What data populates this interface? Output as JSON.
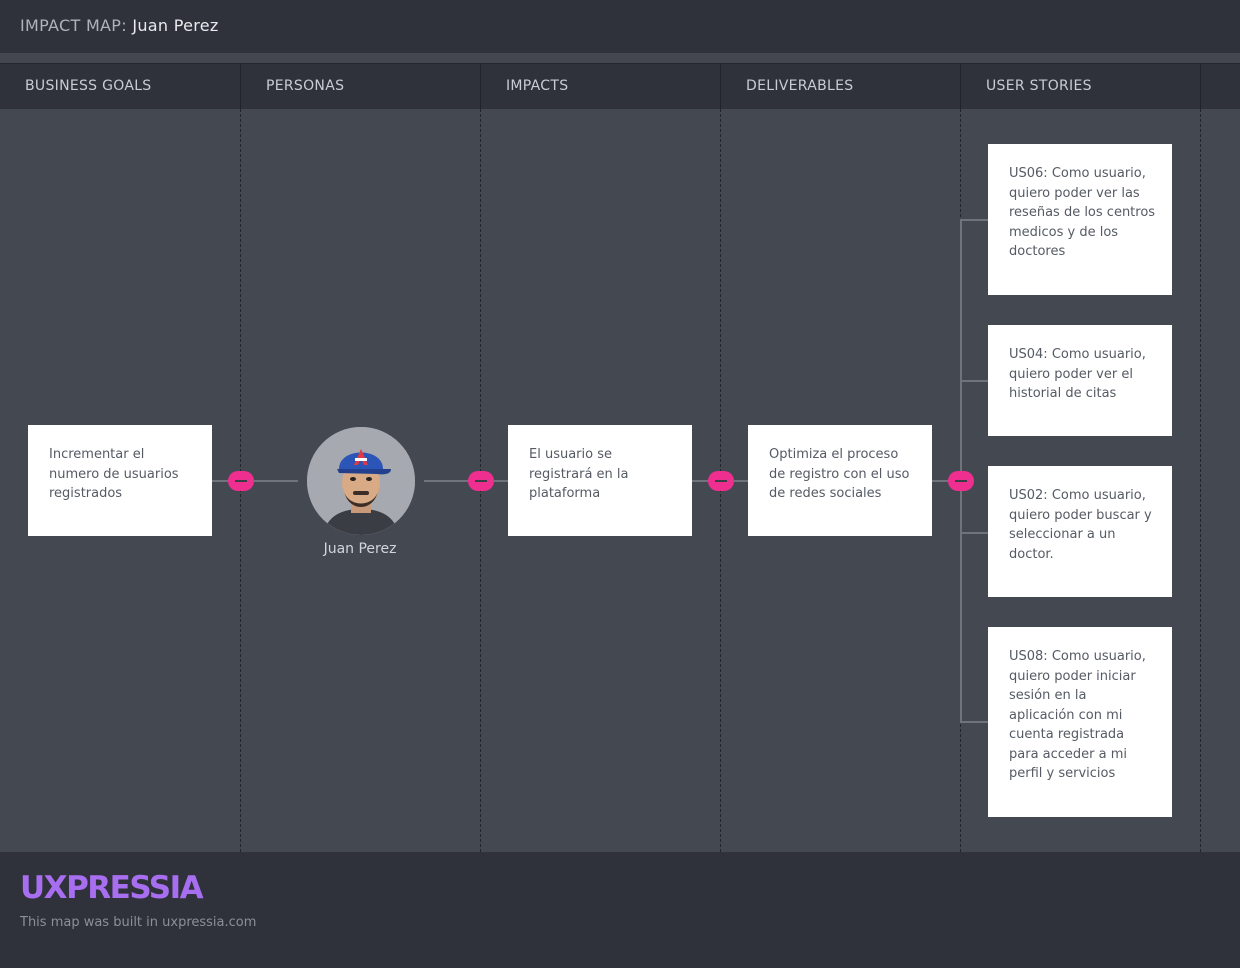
{
  "header": {
    "title_label": "IMPACT MAP:",
    "title_name": "Juan Perez"
  },
  "columns": [
    "BUSINESS GOALS",
    "PERSONAS",
    "IMPACTS",
    "DELIVERABLES",
    "USER STORIES"
  ],
  "nodes": {
    "business_goal": "Incrementar el numero de usuarios registrados",
    "persona": {
      "name": "Juan Perez",
      "icon": "avatar-photo"
    },
    "impact": "El usuario se registrará en la plataforma",
    "deliverable": "Optimiza el proceso de registro con el uso de redes sociales",
    "user_stories": [
      "US06: Como usuario, quiero poder ver las reseñas de los centros medicos y de los doctores",
      "US04: Como usuario, quiero poder ver el historial de citas",
      "US02: Como usuario, quiero poder buscar y seleccionar a un doctor.",
      "US08: Como usuario, quiero poder iniciar sesión en la aplicación con mi cuenta registrada para acceder a mi perfil y servicios"
    ]
  },
  "colors": {
    "accent": "#ee2f8f",
    "brand": "#a86ef0",
    "canvas": "#444851",
    "bar": "#2f323b"
  },
  "footer": {
    "brand": "UXPRESSIA",
    "credit": "This map was built in uxpressia.com"
  }
}
